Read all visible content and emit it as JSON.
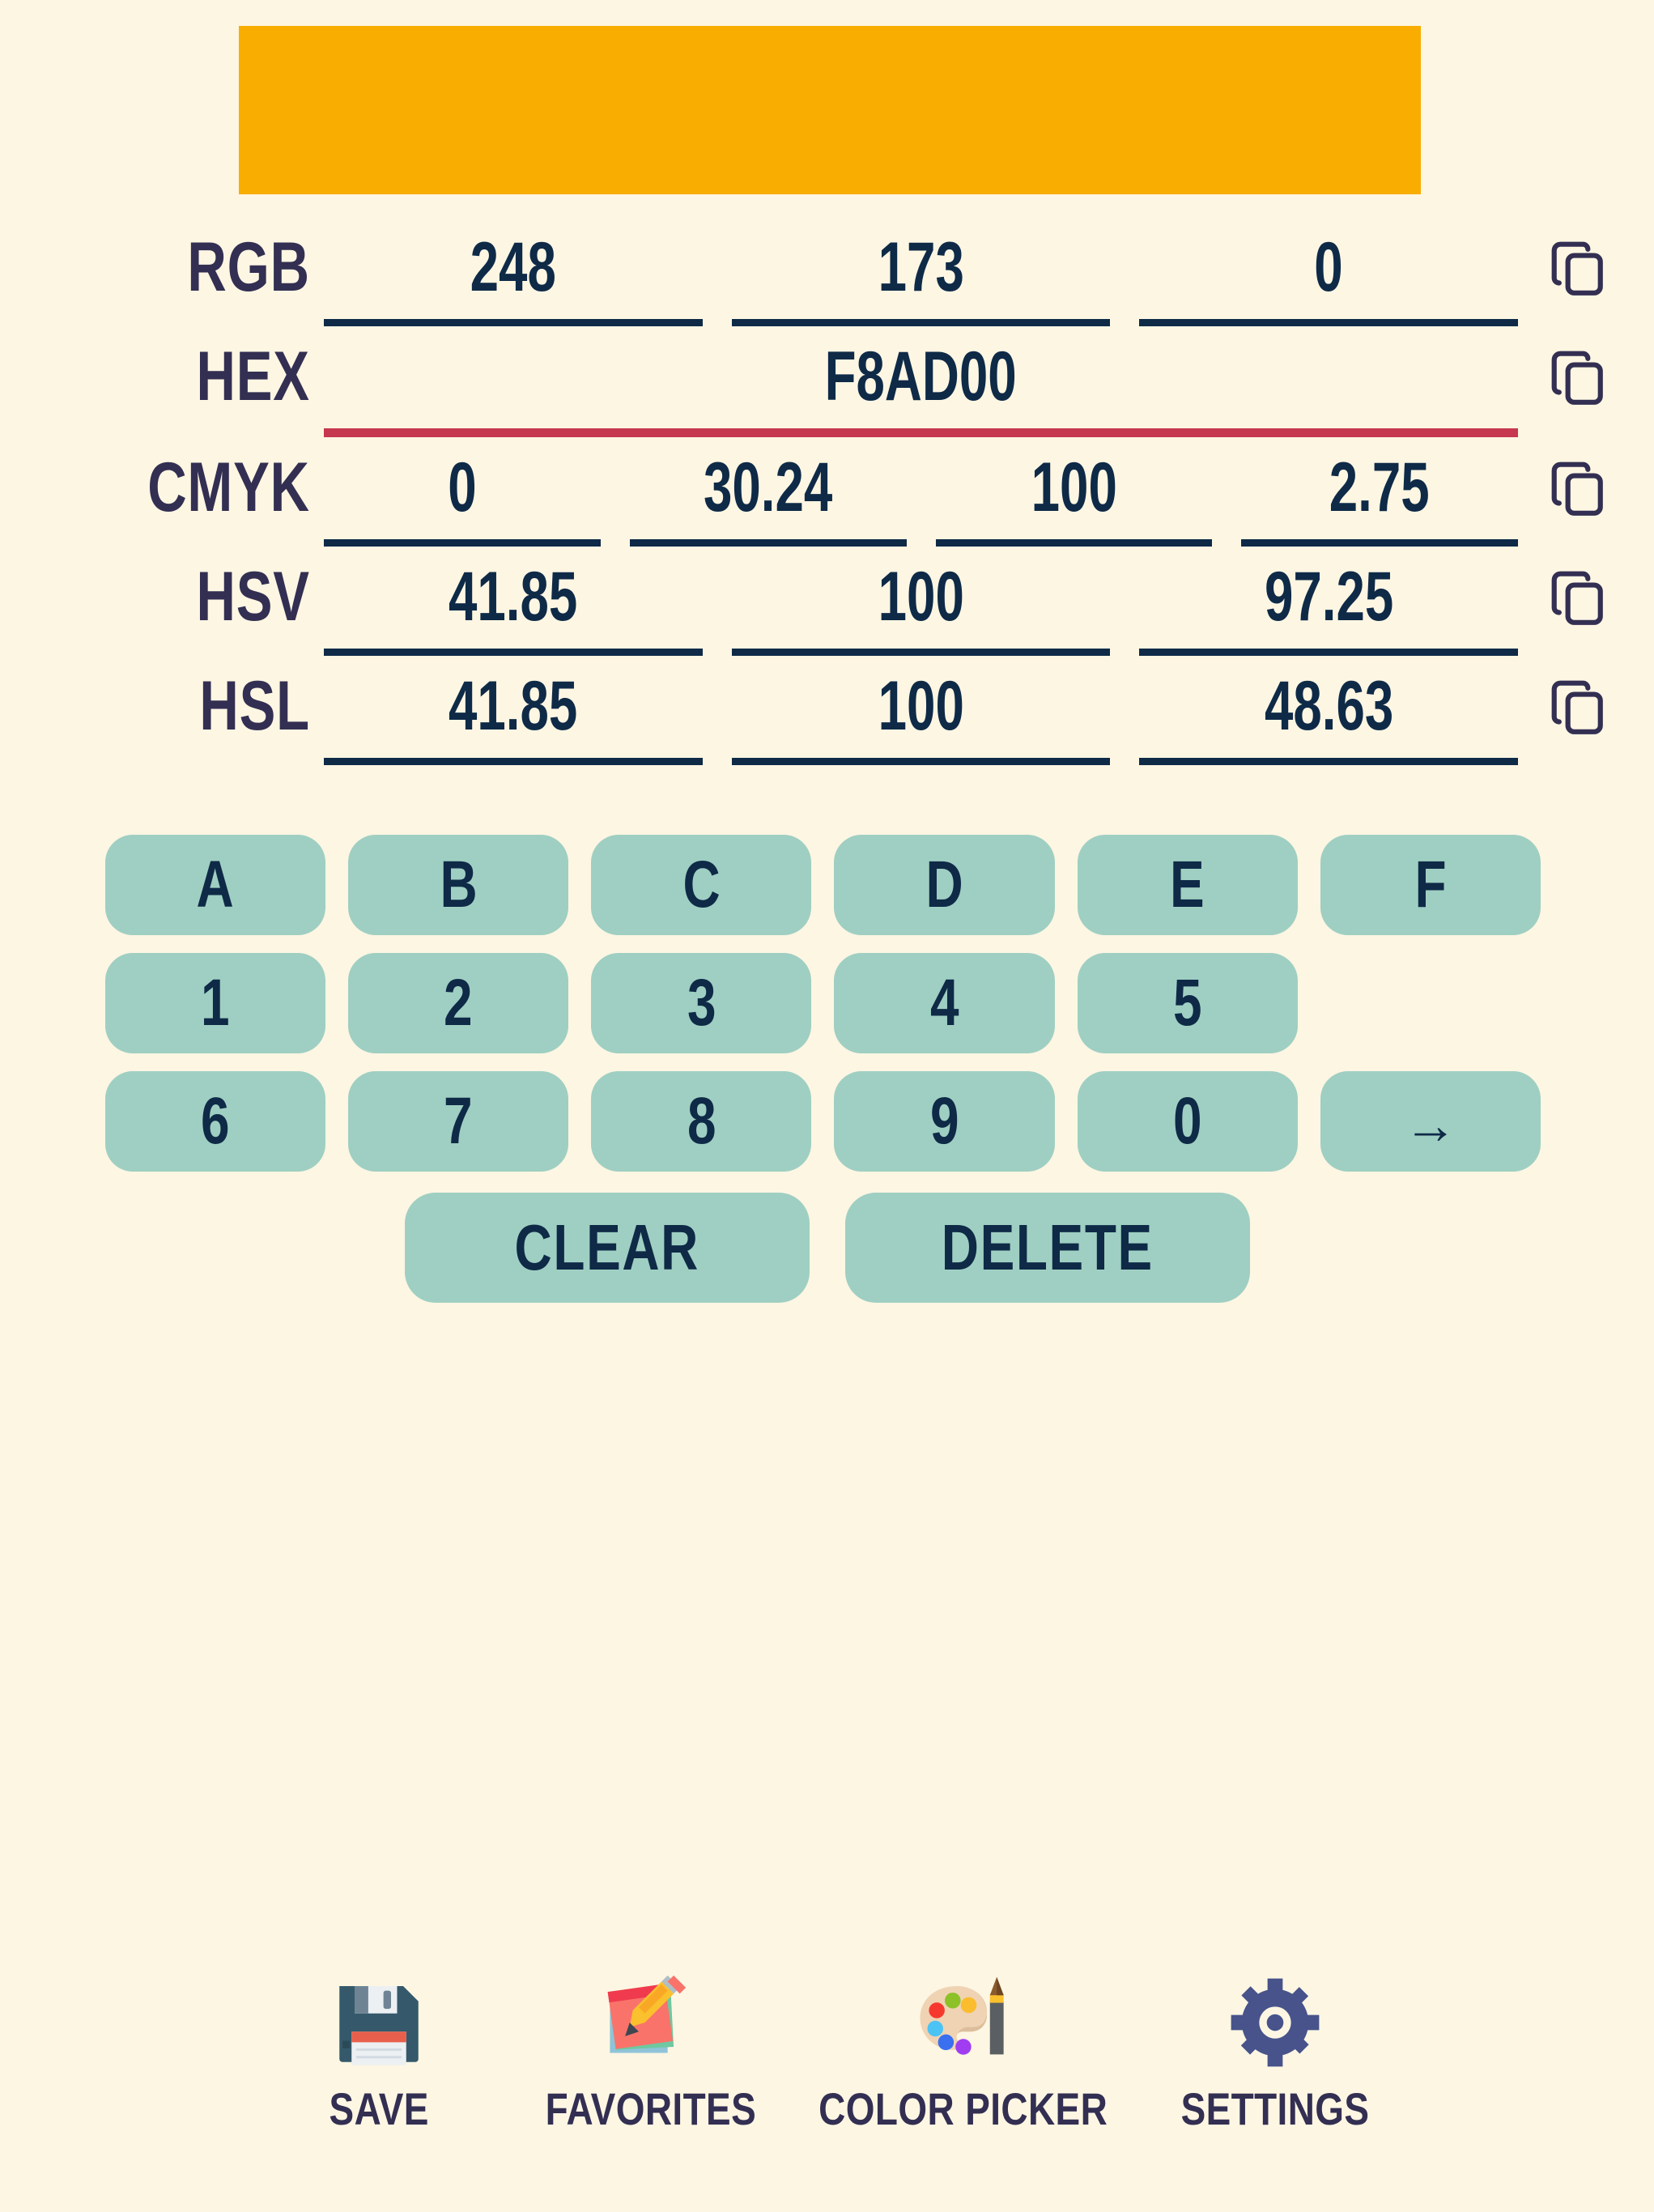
{
  "theme": {
    "background": "#FDF6E3",
    "text_dark": "#0E2A47",
    "label_purple": "#332F52",
    "key_mint": "#9FCFC2",
    "accent_red": "#C6384F",
    "swatch": "#F8AD00",
    "gear_blue": "#47538A"
  },
  "swatch": {
    "color": "#F8AD00"
  },
  "conversions": {
    "rgb": {
      "label": "RGB",
      "values": [
        "248",
        "173",
        "0"
      ],
      "rule": "normal",
      "copy_icon": "copy-icon"
    },
    "hex": {
      "label": "HEX",
      "values": [
        "F8AD00"
      ],
      "rule": "accent",
      "copy_icon": "copy-icon"
    },
    "cmyk": {
      "label": "CMYK",
      "values": [
        "0",
        "30.24",
        "100",
        "2.75"
      ],
      "rule": "normal",
      "copy_icon": "copy-icon"
    },
    "hsv": {
      "label": "HSV",
      "values": [
        "41.85",
        "100",
        "97.25"
      ],
      "rule": "normal",
      "copy_icon": "copy-icon"
    },
    "hsl": {
      "label": "HSL",
      "values": [
        "41.85",
        "100",
        "48.63"
      ],
      "rule": "normal",
      "copy_icon": "copy-icon"
    }
  },
  "keypad": {
    "rows": [
      [
        "A",
        "B",
        "C",
        "D",
        "E",
        "F"
      ],
      [
        "1",
        "2",
        "3",
        "4",
        "5",
        ""
      ],
      [
        "6",
        "7",
        "8",
        "9",
        "0",
        "→"
      ]
    ],
    "arrow_label": "→",
    "clear_label": "CLEAR",
    "delete_label": "DELETE"
  },
  "bottom_nav": [
    {
      "label": "SAVE",
      "icon": "floppy-disk-icon"
    },
    {
      "label": "FAVORITES",
      "icon": "memo-pencil-icon"
    },
    {
      "label": "COLOR PICKER",
      "icon": "artist-palette-icon"
    },
    {
      "label": "SETTINGS",
      "icon": "gear-icon"
    }
  ]
}
